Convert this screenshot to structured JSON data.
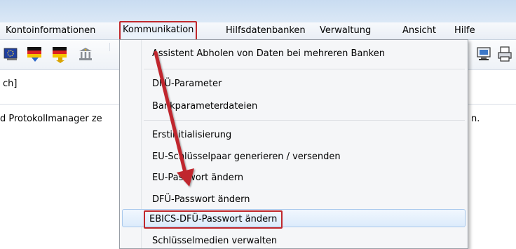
{
  "menubar": {
    "items": [
      {
        "label": "Kontoinformationen"
      },
      {
        "label": "Kommunikation"
      },
      {
        "label": "Hilfsdatenbanken"
      },
      {
        "label": "Verwaltung"
      },
      {
        "label": "Ansicht"
      },
      {
        "label": "Hilfe"
      }
    ]
  },
  "toolbar": {
    "icons": [
      "eu-flag-icon",
      "german-flag-icon",
      "german-flag-icon",
      "bank-icon",
      "computer-icon",
      "printer-icon"
    ]
  },
  "field": {
    "text": "ch]"
  },
  "status": {
    "text": "d Protokollmanager ze",
    "tail": "n."
  },
  "dropdown": {
    "items": [
      {
        "label": "Assistent Abholen von Daten bei mehreren Banken"
      },
      {
        "label": "DFÜ-Parameter"
      },
      {
        "label": "Bankparameterdateien"
      },
      {
        "label": "Erstinitialisierung"
      },
      {
        "label": "EU-Schlüsselpaar generieren / versenden"
      },
      {
        "label": "EU-Passwort ändern"
      },
      {
        "label": "DFÜ-Passwort ändern"
      },
      {
        "label": "EBICS-DFÜ-Passwort ändern"
      },
      {
        "label": "Schlüsselmedien verwalten"
      }
    ]
  },
  "colors": {
    "highlight_box": "#c0282d",
    "arrow": "#c0282d",
    "menu_hover": "#dcebfb"
  }
}
